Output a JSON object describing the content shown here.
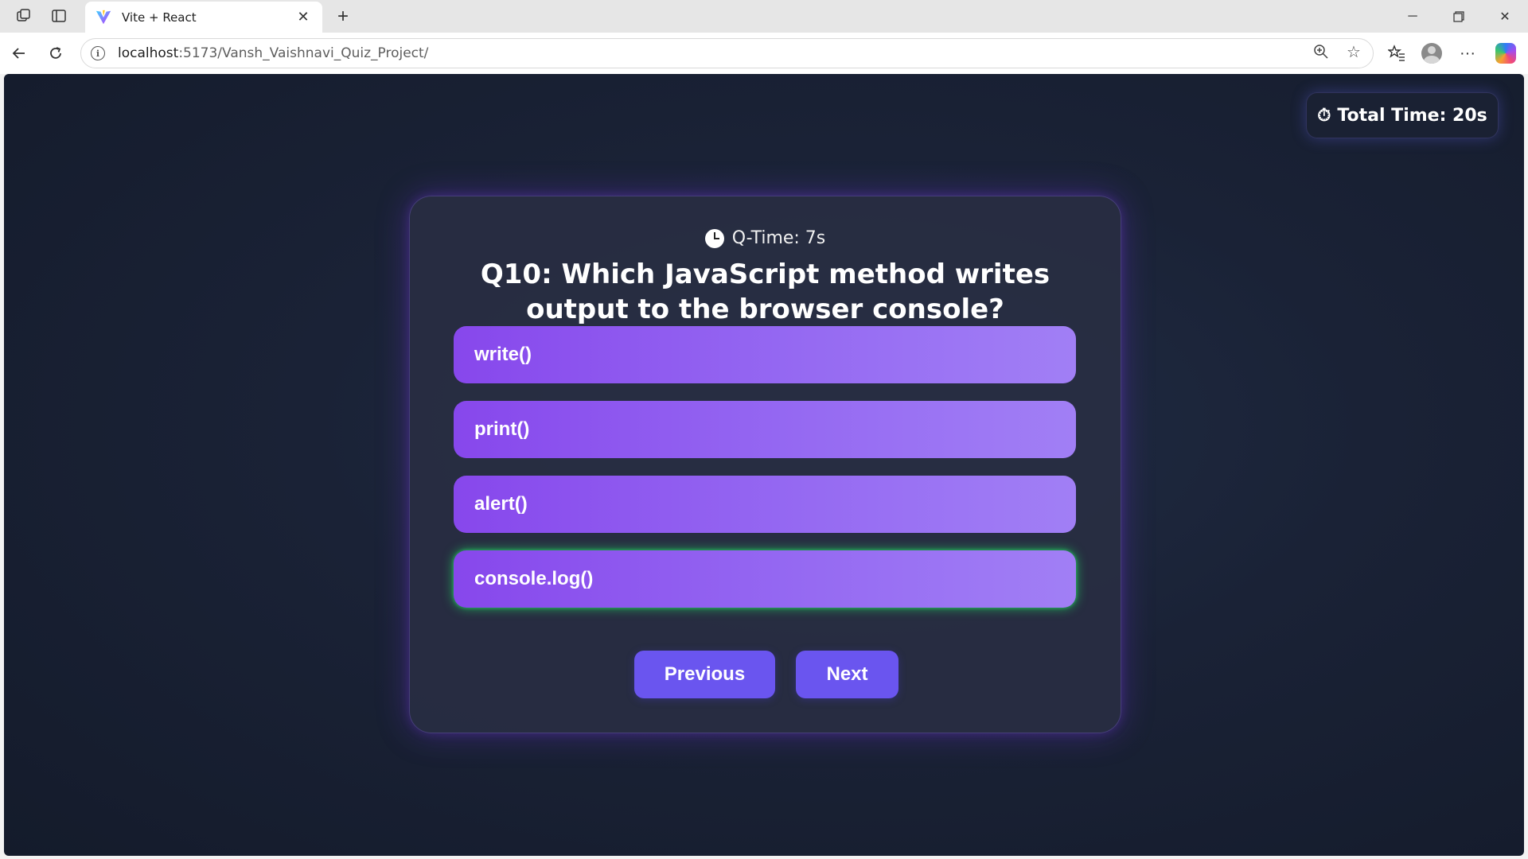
{
  "browser": {
    "tab_title": "Vite + React",
    "url_host": "localhost",
    "url_path": ":5173/Vansh_Vaishnavi_Quiz_Project/"
  },
  "quiz": {
    "total_time_label": "Total Time: 20s",
    "total_time_icon": "⏱",
    "q_time_label": "Q-Time: 7s",
    "question": "Q10: Which JavaScript method writes output to the browser console?",
    "options": [
      {
        "label": "write()",
        "selected": false
      },
      {
        "label": "print()",
        "selected": false
      },
      {
        "label": "alert()",
        "selected": false
      },
      {
        "label": "console.log()",
        "selected": true
      }
    ],
    "previous_label": "Previous",
    "next_label": "Next"
  },
  "colors": {
    "page_bg": "#1a2236",
    "card_bg": "#282e42",
    "option_gradient_start": "#8747ec",
    "option_gradient_end": "#a17ff5",
    "selected_glow": "#22c55e",
    "nav_button": "#6a55ef"
  }
}
